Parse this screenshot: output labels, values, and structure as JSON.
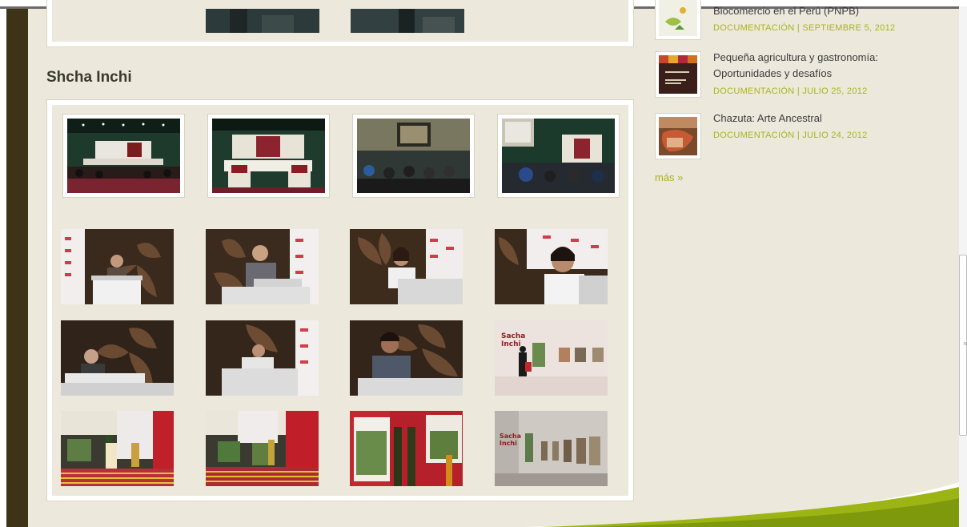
{
  "section": {
    "title": "Shcha Inchi"
  },
  "gallery": {
    "framed_photos": [
      {
        "subject": "auditorium-stage-green-wall"
      },
      {
        "subject": "stage-table-speakers"
      },
      {
        "subject": "audience-projector-screen"
      },
      {
        "subject": "audience-stage-banners"
      }
    ],
    "photos": [
      {
        "subject": "speaker-podium-1"
      },
      {
        "subject": "speaker-podium-2"
      },
      {
        "subject": "speaker-podium-3"
      },
      {
        "subject": "speaker-podium-4"
      },
      {
        "subject": "speaker-podium-5"
      },
      {
        "subject": "speaker-podium-6"
      },
      {
        "subject": "speaker-podium-7"
      },
      {
        "subject": "exhibition-visitor"
      },
      {
        "subject": "product-display-1"
      },
      {
        "subject": "product-display-2"
      },
      {
        "subject": "book-bottles-display"
      },
      {
        "subject": "exhibition-wall"
      }
    ]
  },
  "sidebar": {
    "items": [
      {
        "title": "Biocomercio en el Perú (PNPB)",
        "meta": "DOCUMENTACIÓN | SEPTIEMBRE 5, 2012"
      },
      {
        "title": "Pequeña agricultura y gastronomía: Oportunidades y desafíos",
        "meta": "DOCUMENTACIÓN | JULIO 25, 2012"
      },
      {
        "title": "Chazuta: Arte Ancestral",
        "meta": "DOCUMENTACIÓN | JULIO 24, 2012"
      }
    ],
    "more_label": "más »"
  },
  "colors": {
    "accent_green": "#a7b61b",
    "page_background": "#ece8dc",
    "left_bar": "#3d3417",
    "swoosh": "#9cb514"
  }
}
